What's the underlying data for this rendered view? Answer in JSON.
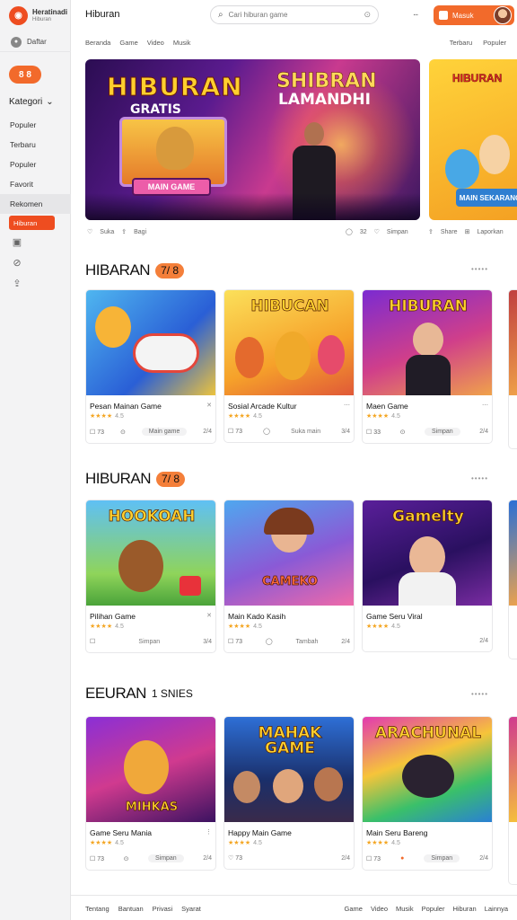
{
  "brand": {
    "name": "Heratinadi",
    "sub": "Hiburan",
    "logo_icon": "logo-icon"
  },
  "sidebar": {
    "top_label": "Daftar",
    "live_badge": "8 8",
    "section_label": "Kategori",
    "items": [
      {
        "label": "Populer"
      },
      {
        "label": "Terbaru"
      },
      {
        "label": "Populer"
      },
      {
        "label": "Favorit"
      },
      {
        "label": "Rekomen",
        "highlight": true
      },
      {
        "label": "Hiburan",
        "active": true
      }
    ],
    "icons": [
      "video-icon",
      "link-icon",
      "share-icon"
    ]
  },
  "header": {
    "title": "Hiburan",
    "search_placeholder": "Cari hiburan game",
    "join_label": "Masuk"
  },
  "subnav": {
    "left": [
      "Beranda",
      "Game",
      "Video",
      "Musik"
    ],
    "right": [
      "Terbaru",
      "Populer"
    ]
  },
  "hero": {
    "title": "HIBURAN",
    "subtitle": "GRATIS",
    "right_title": "SHIBRAN",
    "right_sub": "LAMANDHI",
    "cta": "MAIN GAME",
    "side_title": "HIBURAN",
    "side_cta": "MAIN SEKARANG",
    "meta_left": [
      "Suka",
      "Bagi"
    ],
    "meta_mid": [
      "32",
      "Simpan"
    ],
    "meta_right": [
      "Share",
      "Laporkan"
    ]
  },
  "sections": [
    {
      "title": "HIBARAN",
      "tag": "7/ 8",
      "more": "•••••",
      "cards": [
        {
          "img_title": "",
          "title": "Pesan Mainan Game",
          "rating": "★★★★",
          "rating_count": "4.5",
          "count": "73",
          "pill": "Main game",
          "num": "2/4"
        },
        {
          "img_title": "HIBUCAN",
          "title": "Sosial Arcade Kultur",
          "rating": "★★★★",
          "rating_count": "4.5",
          "count": "73",
          "pill": "Suka main",
          "num": "3/4"
        },
        {
          "img_title": "HIBURAN",
          "title": "Maen Game",
          "rating": "★★★★",
          "rating_count": "4.5",
          "count": "33",
          "pill": "Simpan",
          "num": "2/4"
        }
      ]
    },
    {
      "title": "HIBURAN",
      "tag": "7/ 8",
      "more": "•••••",
      "cards": [
        {
          "img_title": "HOOKOAH",
          "title": "Pilihan Game",
          "rating": "★★★★",
          "rating_count": "4.5",
          "count": "",
          "pill": "Simpan",
          "num": "3/4"
        },
        {
          "img_title": "CAMEKO",
          "title": "Main Kado Kasih",
          "rating": "★★★★",
          "rating_count": "4.5",
          "count": "73",
          "pill": "Tambah",
          "num": "2/4"
        },
        {
          "img_title": "Gamelty",
          "title": "Game Seru Viral",
          "rating": "★★★★",
          "rating_count": "4.5",
          "count": "",
          "pill": "",
          "num": "2/4"
        }
      ]
    },
    {
      "title": "EEURAN",
      "tag": "1 SNIES",
      "more": "•••••",
      "cards": [
        {
          "img_title": "MIHKAS",
          "title": "Game Seru Mania",
          "rating": "★★★★",
          "rating_count": "4.5",
          "count": "73",
          "pill": "Simpan",
          "num": "2/4"
        },
        {
          "img_title": "MAHAK GAME",
          "title": "Happy Main Game",
          "rating": "★★★★",
          "rating_count": "4.5",
          "count": "73",
          "pill": "",
          "num": "2/4"
        },
        {
          "img_title": "ARACHUNAL",
          "title": "Main Seru Bareng",
          "rating": "★★★★",
          "rating_count": "4.5",
          "count": "73",
          "pill": "Simpan",
          "num": "2/4"
        }
      ]
    }
  ],
  "bottom": {
    "left": [
      "Tentang",
      "Bantuan",
      "Privasi",
      "Syarat"
    ],
    "right": [
      "Game",
      "Video",
      "Musik",
      "Populer",
      "Hiburan",
      "Lainnya"
    ]
  },
  "colors": {
    "accent": "#f26a2b",
    "brand": "#ee4d20",
    "sidebar_bg": "#f3f3f4"
  }
}
